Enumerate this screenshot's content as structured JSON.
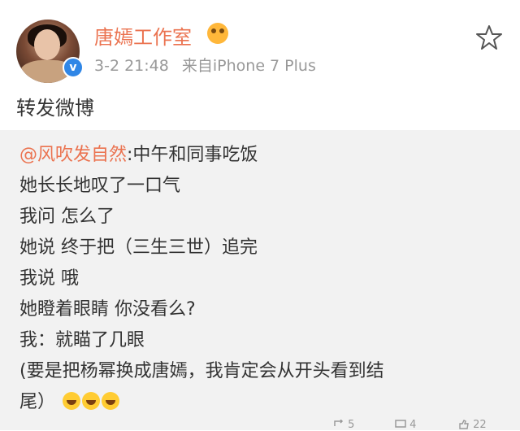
{
  "post": {
    "username": "唐嫣工作室",
    "timestamp": "3-2 21:48",
    "source": "来自iPhone 7 Plus",
    "verified_icon": "verified-badge-icon",
    "repost_title": "转发微博"
  },
  "repost": {
    "mention": "@风吹发自然",
    "lines": [
      ":中午和同事吃饭",
      "她长长地叹了一口气",
      "我问 怎么了",
      "她说 终于把（三生三世）追完",
      "我说 哦",
      "她瞪着眼睛 你没看么?",
      "我：就瞄了几眼",
      "(要是把杨幂换成唐嫣，我肯定会从开头看到结",
      "尾）"
    ]
  },
  "actions": {
    "repost_count": "5",
    "comment_count": "4",
    "like_count": "22"
  },
  "colors": {
    "username": "#eb7350",
    "mention": "#eb7350",
    "meta": "#999999",
    "repost_bg": "#f2f2f2"
  }
}
